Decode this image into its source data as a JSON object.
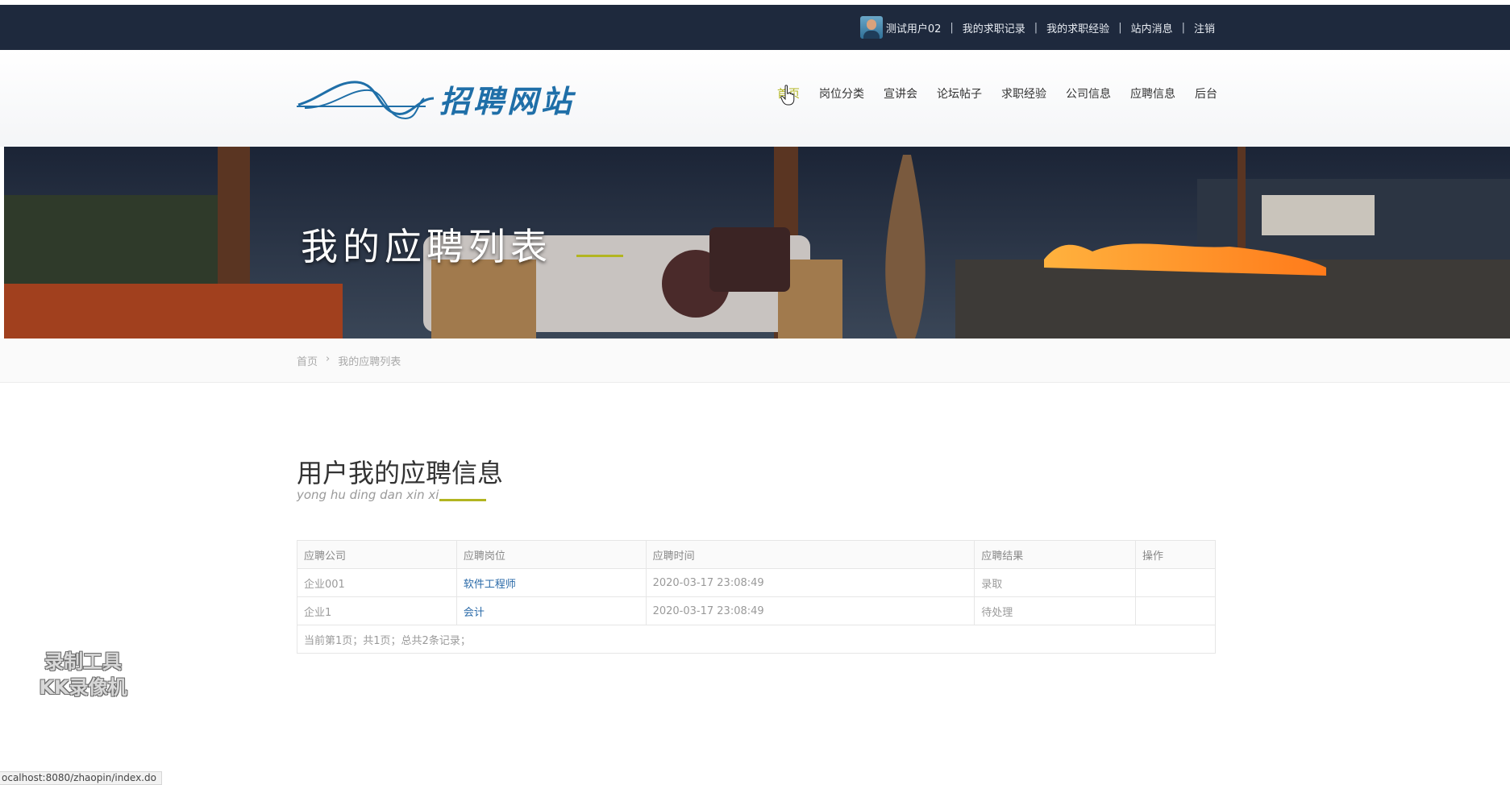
{
  "topbar": {
    "user": "测试用户02",
    "links": [
      "我的求职记录",
      "我的求职经验",
      "站内消息",
      "注销"
    ]
  },
  "header": {
    "logo_text": "招聘网站",
    "nav": [
      "首页",
      "岗位分类",
      "宣讲会",
      "论坛帖子",
      "求职经验",
      "公司信息",
      "应聘信息",
      "后台"
    ]
  },
  "banner": {
    "title": "我的应聘列表"
  },
  "breadcrumb": {
    "home": "首页",
    "separator": "›",
    "current": "我的应聘列表"
  },
  "section": {
    "title": "用户我的应聘信息",
    "subtitle": "yong hu ding dan xin xi"
  },
  "table": {
    "headers": [
      "应聘公司",
      "应聘岗位",
      "应聘时间",
      "应聘结果",
      "操作"
    ],
    "rows": [
      [
        "企业001",
        "软件工程师",
        "2020-03-17 23:08:49",
        "录取",
        ""
      ],
      [
        "企业1",
        "会计",
        "2020-03-17 23:08:49",
        "待处理",
        ""
      ]
    ],
    "pager": "当前第1页；共1页；总共2条记录；"
  },
  "watermark": {
    "line1": "录制工具",
    "line2": "KK录像机"
  },
  "statusbar": {
    "url": "ocalhost:8080/zhaopin/index.do"
  },
  "colors": {
    "topbar": "#1e293d",
    "accent": "#b2b521",
    "link": "#2a6aa8"
  }
}
